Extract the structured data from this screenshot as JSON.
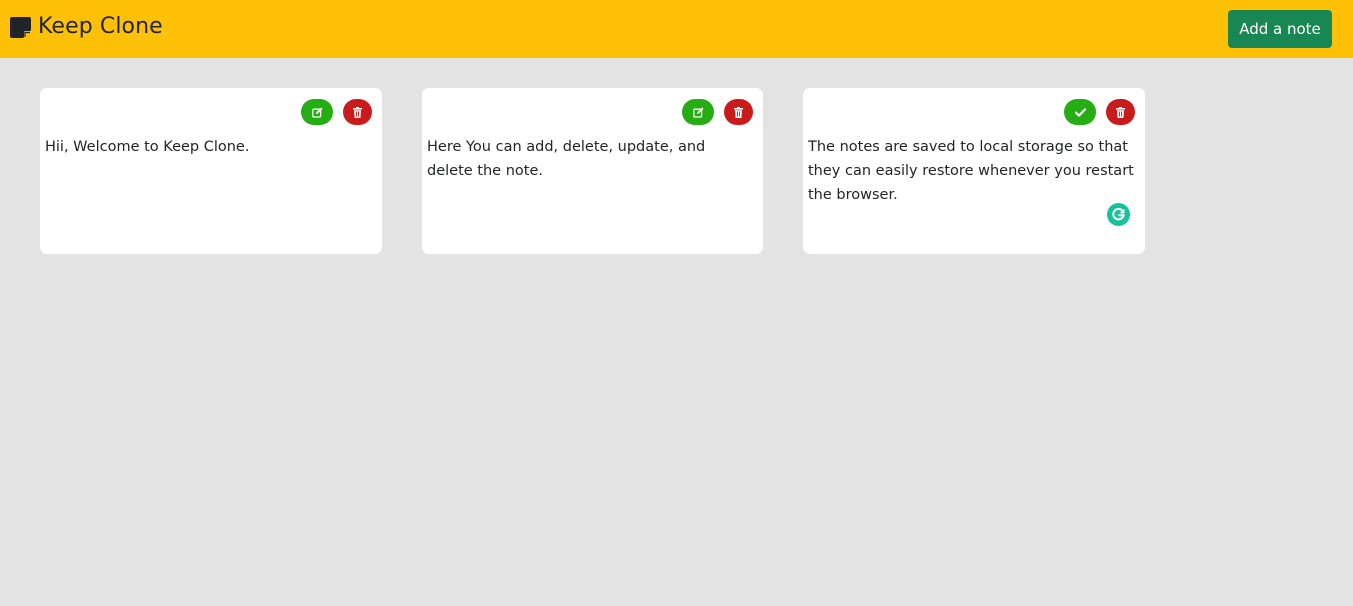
{
  "header": {
    "logo_icon": "sticky-note-icon",
    "title": "Keep Clone",
    "add_button_label": "Add a note",
    "background_color": "#ffc107",
    "add_button_color": "#198754"
  },
  "notes": [
    {
      "text": "Hii, Welcome to Keep Clone.",
      "mode": "view",
      "primary_icon": "edit-icon",
      "secondary_icon": "trash-icon"
    },
    {
      "text": "Here You can add, delete, update, and delete the note.",
      "mode": "view",
      "primary_icon": "edit-icon",
      "secondary_icon": "trash-icon"
    },
    {
      "text": "The notes are saved to local storage so that they can easily restore whenever you restart the browser.",
      "mode": "edit",
      "primary_icon": "check-icon",
      "secondary_icon": "trash-icon"
    }
  ],
  "colors": {
    "page_background": "#e3e3e3",
    "edit_button": "#25ad13",
    "delete_button": "#c91b1b",
    "grammarly_badge": "#15c39a"
  }
}
